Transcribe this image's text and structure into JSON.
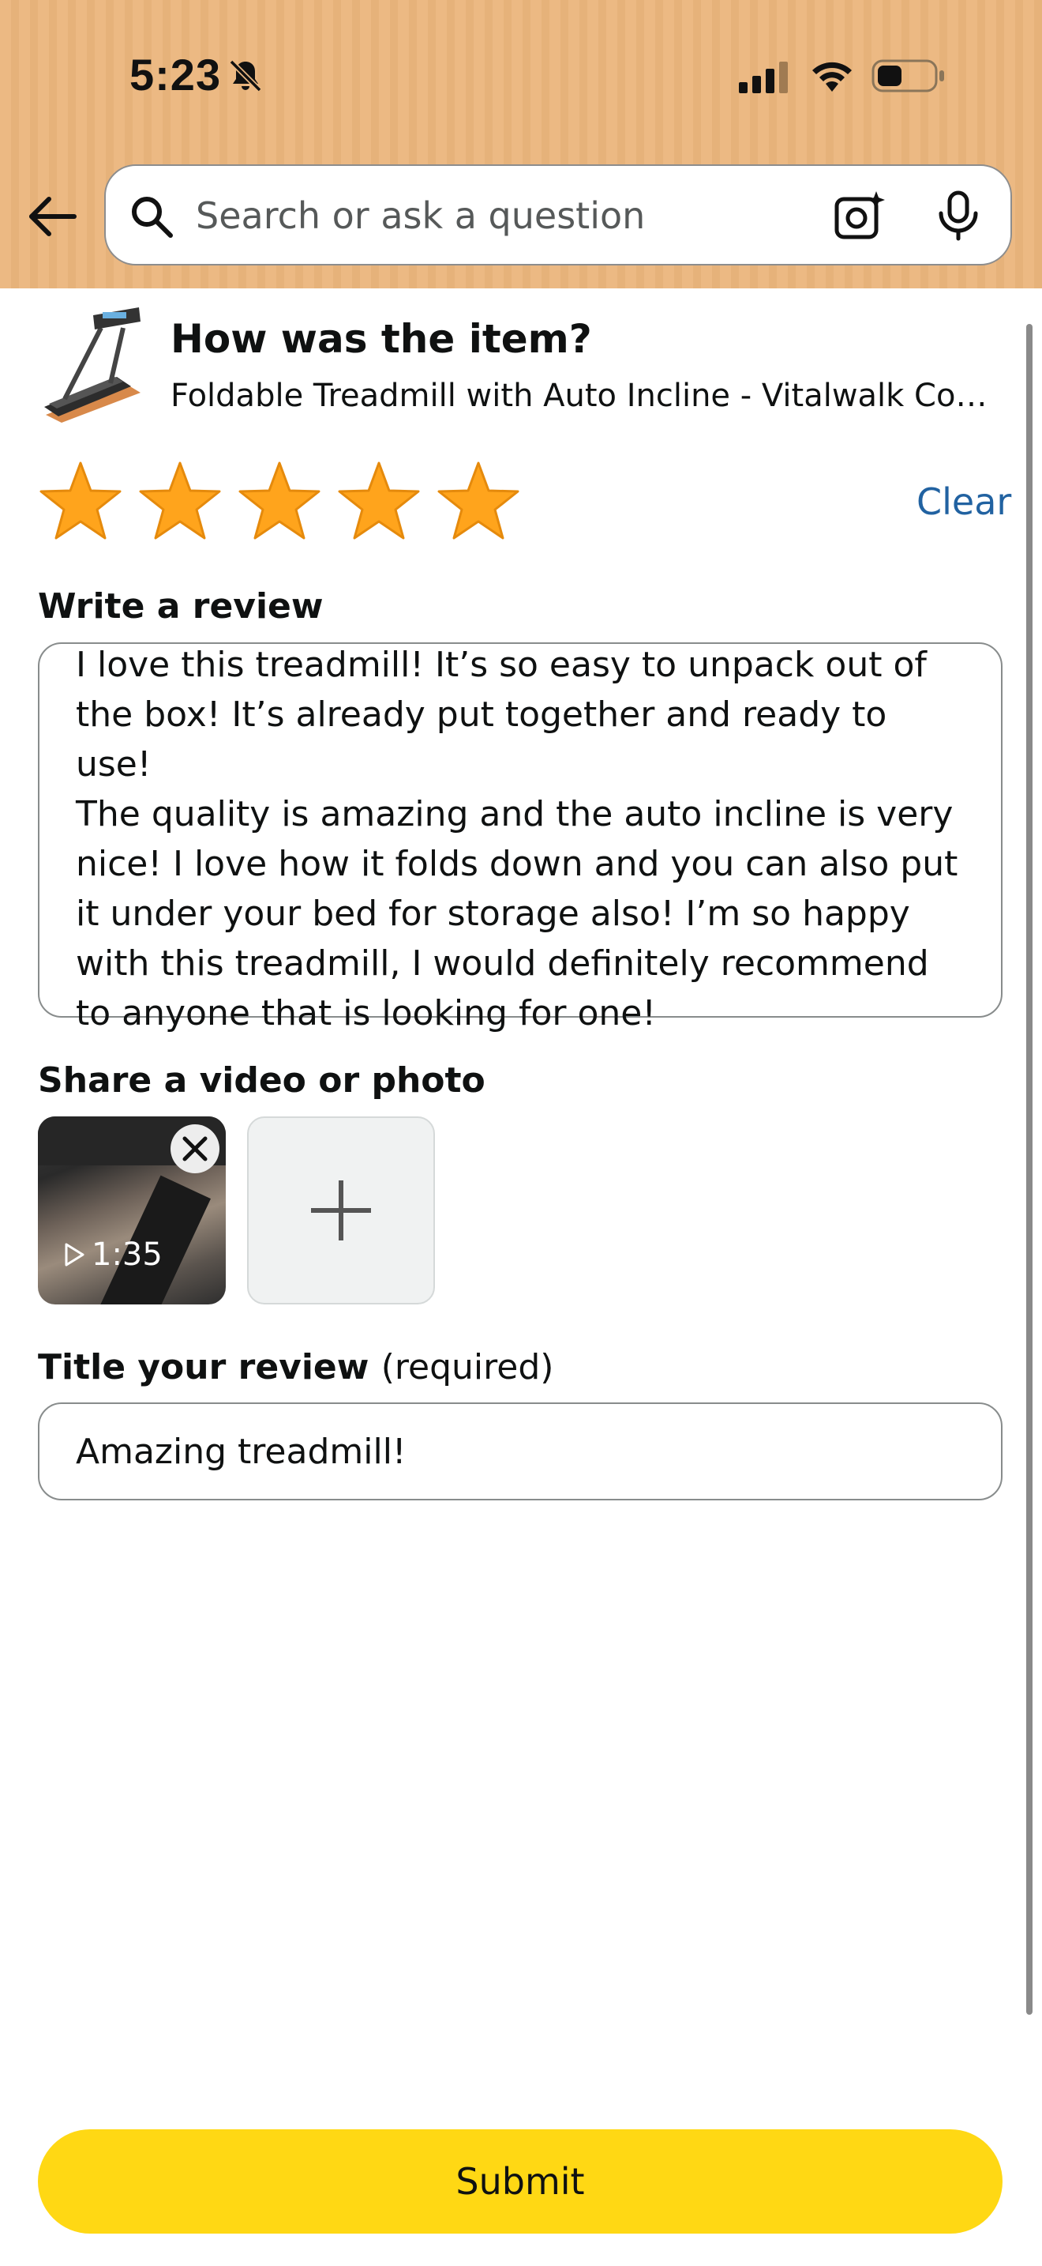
{
  "status_bar": {
    "time": "5:23"
  },
  "search": {
    "placeholder": "Search or ask a question"
  },
  "product": {
    "question": "How was the item?",
    "name": "Foldable Treadmill with Auto Incline - Vitalwalk Com…"
  },
  "rating": {
    "value": 5,
    "max": 5,
    "clear_label": "Clear",
    "star_color": "#ffa41c"
  },
  "review": {
    "section_label": "Write a review",
    "text": "I love this treadmill! It’s so easy to unpack out of\nthe box! It’s already put together and ready to use!\nThe quality is amazing and the auto incline is very\nnice! I love how it folds down and you can also put\nit under your bed for storage also! I’m so happy\nwith this treadmill, I would definitely recommend\nto anyone that is looking for one!"
  },
  "media": {
    "section_label": "Share a video or photo",
    "video_duration": "1:35"
  },
  "title": {
    "section_label": "Title your review",
    "required_note": "(required)",
    "value": "Amazing treadmill!"
  },
  "submit": {
    "label": "Submit",
    "color": "#ffd814"
  }
}
